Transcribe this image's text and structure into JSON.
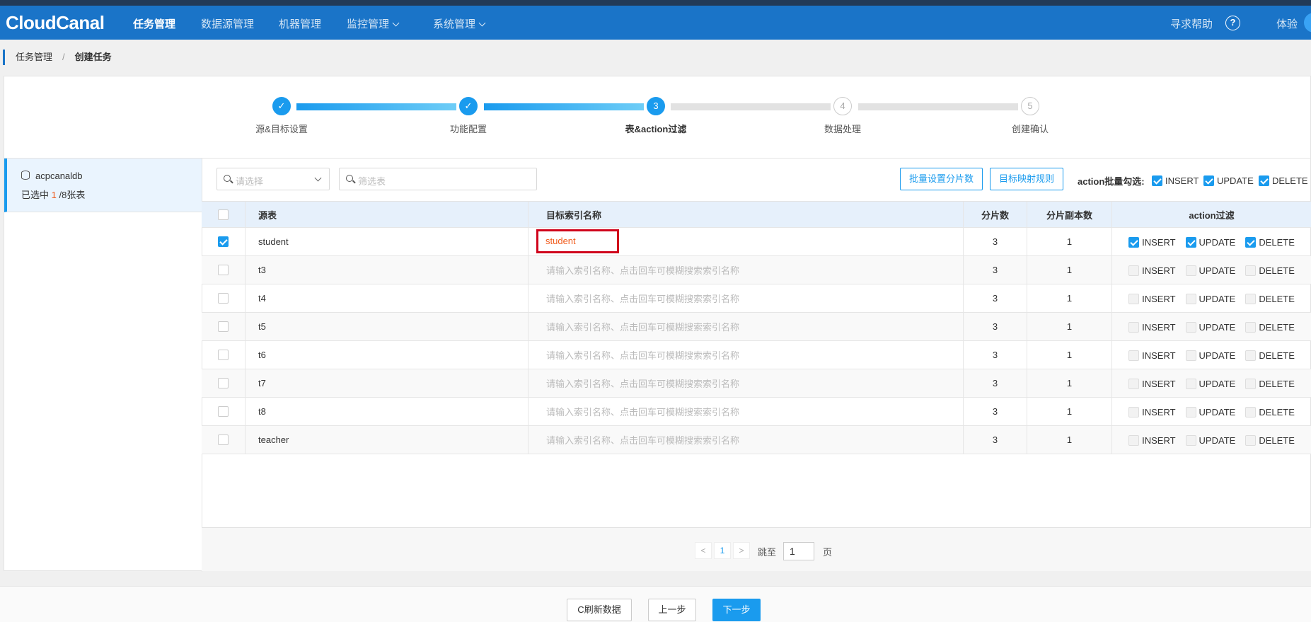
{
  "nav": {
    "logo": "CloudCanal",
    "items": [
      {
        "label": "任务管理",
        "active": true
      },
      {
        "label": "数据源管理"
      },
      {
        "label": "机器管理"
      },
      {
        "label": "监控管理"
      },
      {
        "label": "系统管理"
      }
    ],
    "help": "寻求帮助",
    "help_icon": "?",
    "user": "体验"
  },
  "breadcrumb": {
    "parent": "任务管理",
    "separator": "/",
    "current": "创建任务"
  },
  "steps": [
    {
      "label": "源&目标设置",
      "status": "done",
      "num": "✓"
    },
    {
      "label": "功能配置",
      "status": "done",
      "num": "✓"
    },
    {
      "label": "表&action过滤",
      "status": "current",
      "num": "3"
    },
    {
      "label": "数据处理",
      "status": "todo",
      "num": "4"
    },
    {
      "label": "创建确认",
      "status": "todo",
      "num": "5"
    }
  ],
  "db": {
    "name": "acpcanaldb",
    "selected_prefix": "已选中 ",
    "selected_count": "1",
    "selected_suffix": " /8张表"
  },
  "toolbar": {
    "select_placeholder": "请选择",
    "filter_placeholder": "筛选表",
    "batch_shard_button": "批量设置分片数",
    "mapping_rule_button": "目标映射规则",
    "batch_label": "action批量勾选:",
    "batch_actions": [
      "INSERT",
      "UPDATE",
      "DELETE"
    ]
  },
  "table": {
    "headers": {
      "source": "源表",
      "target": "目标索引名称",
      "shards": "分片数",
      "replicas": "分片副本数",
      "action": "action过滤"
    },
    "target_placeholder": "请输入索引名称、点击回车可模糊搜索索引名称",
    "action_labels": [
      "INSERT",
      "UPDATE",
      "DELETE"
    ],
    "rows": [
      {
        "source": "student",
        "target": "student",
        "shards": "3",
        "replicas": "1",
        "checked": true
      },
      {
        "source": "t3",
        "target": "",
        "shards": "3",
        "replicas": "1",
        "checked": false
      },
      {
        "source": "t4",
        "target": "",
        "shards": "3",
        "replicas": "1",
        "checked": false
      },
      {
        "source": "t5",
        "target": "",
        "shards": "3",
        "replicas": "1",
        "checked": false
      },
      {
        "source": "t6",
        "target": "",
        "shards": "3",
        "replicas": "1",
        "checked": false
      },
      {
        "source": "t7",
        "target": "",
        "shards": "3",
        "replicas": "1",
        "checked": false
      },
      {
        "source": "t8",
        "target": "",
        "shards": "3",
        "replicas": "1",
        "checked": false
      },
      {
        "source": "teacher",
        "target": "",
        "shards": "3",
        "replicas": "1",
        "checked": false
      }
    ]
  },
  "pager": {
    "prev": "<",
    "page": "1",
    "next": ">",
    "jump_label": "跳至",
    "jump_value": "1",
    "page_suffix": "页"
  },
  "footer": {
    "refresh": "刷新数据",
    "refresh_icon": "C",
    "prev": "上一步",
    "next": "下一步"
  }
}
